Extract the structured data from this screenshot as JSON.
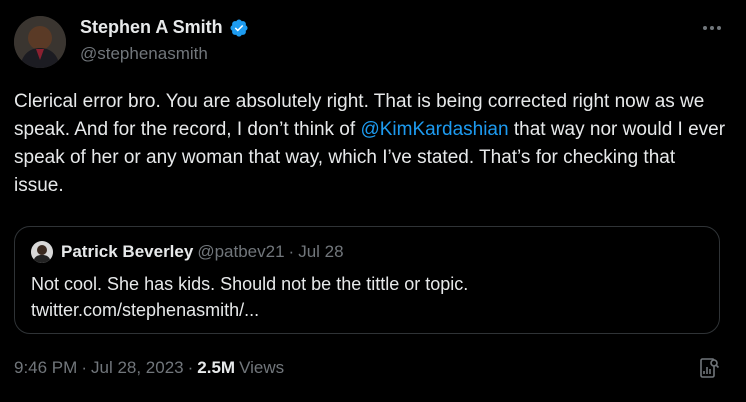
{
  "author": {
    "name": "Stephen A Smith",
    "handle": "@stephenasmith"
  },
  "tweet": {
    "text_part1": "Clerical error bro. You are absolutely right.  That is being corrected right now as we speak. And for the record, I don’t think of ",
    "mention": "@KimKardashian",
    "text_part2": " that way nor would I ever speak of her or any woman that way, which I’ve stated. That’s for checking that issue."
  },
  "quote": {
    "name": "Patrick Beverley",
    "handle": "@patbev21",
    "separator": "·",
    "date": "Jul 28",
    "text": "Not cool. She has kids. Should not be the tittle or topic.",
    "link": "twitter.com/stephenasmith/..."
  },
  "footer": {
    "time": "9:46 PM",
    "separator": "·",
    "date": "Jul 28, 2023",
    "dot": "·",
    "views_count": "2.5M",
    "views_label": "Views"
  },
  "icons": {
    "verified": "verified-badge-icon",
    "more": "more-options-icon",
    "analytics": "analytics-icon"
  },
  "colors": {
    "background": "#000000",
    "text": "#e7e9ea",
    "muted": "#71767b",
    "accent": "#1d9bf0",
    "border": "#2f3336"
  }
}
